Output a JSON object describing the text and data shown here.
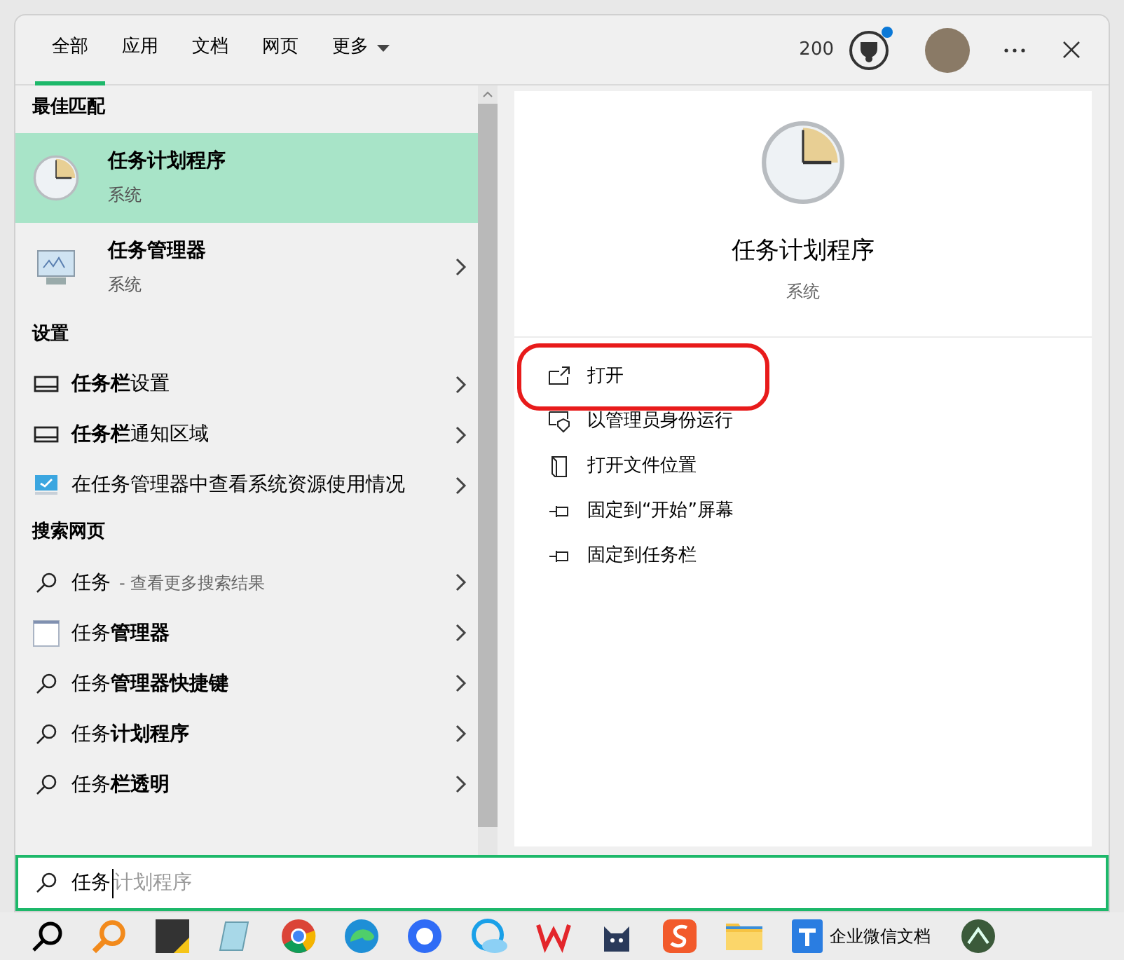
{
  "tabs": [
    {
      "label": "全部",
      "selected": true
    },
    {
      "label": "应用",
      "selected": false
    },
    {
      "label": "文档",
      "selected": false
    },
    {
      "label": "网页",
      "selected": false
    },
    {
      "label": "更多",
      "selected": false,
      "dropdown": true
    }
  ],
  "points": "200",
  "sections": [
    {
      "heading": "最佳匹配",
      "items": [
        {
          "kind": "clock",
          "title": "任务计划程序",
          "subtitle": "系统",
          "selected": true,
          "chevron": false
        },
        {
          "kind": "monitor",
          "title": "任务管理器",
          "subtitle": "系统",
          "selected": false,
          "chevron": true
        }
      ]
    },
    {
      "heading": "设置",
      "items": [
        {
          "kind": "taskbar",
          "title": "**任务栏**设置"
        },
        {
          "kind": "taskbar",
          "title": "**任务栏**通知区域"
        },
        {
          "kind": "screen",
          "title": "在任务管理器中查看系统资源使用情况"
        }
      ]
    },
    {
      "heading": "搜索网页",
      "items": [
        {
          "kind": "search",
          "title": "任务",
          "hint": "- 查看更多搜索结果"
        },
        {
          "kind": "window",
          "title": "任务**管理器**"
        },
        {
          "kind": "search",
          "title": "任务**管理器快捷键**"
        },
        {
          "kind": "search",
          "title": "任务**计划程序**"
        },
        {
          "kind": "search",
          "title": "任务**栏透明**"
        }
      ]
    }
  ],
  "detail": {
    "title": "任务计划程序",
    "subtitle": "系统",
    "actions": [
      {
        "label": "打开",
        "kind": "open",
        "highlighted": true
      },
      {
        "label": "以管理员身份运行",
        "kind": "shield",
        "highlighted": false
      },
      {
        "label": "打开文件位置",
        "kind": "file",
        "highlighted": false
      },
      {
        "label": "固定到“开始”屏幕",
        "kind": "pin",
        "highlighted": false
      },
      {
        "label": "固定到任务栏",
        "kind": "pin",
        "highlighted": false
      }
    ]
  },
  "search": {
    "value": "任务",
    "suggestion": "计划程序"
  },
  "taskbar": [
    {
      "kind": "search"
    },
    {
      "kind": "magnifier"
    },
    {
      "kind": "note"
    },
    {
      "kind": "notepad"
    },
    {
      "kind": "chrome"
    },
    {
      "kind": "edge"
    },
    {
      "kind": "dot"
    },
    {
      "kind": "cloud"
    },
    {
      "kind": "wps"
    },
    {
      "kind": "cat"
    },
    {
      "kind": "sogou"
    },
    {
      "kind": "folder"
    },
    {
      "kind": "doc",
      "label": "企业微信文档"
    },
    {
      "kind": "partial"
    }
  ]
}
